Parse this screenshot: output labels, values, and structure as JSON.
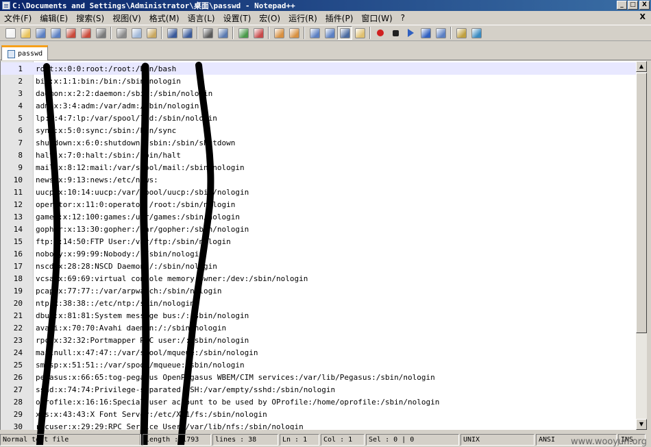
{
  "window": {
    "title": "C:\\Documents and Settings\\Administrator\\桌面\\passwd - Notepad++",
    "caption_buttons": {
      "minimize": "_",
      "maximize": "□",
      "close": "X"
    }
  },
  "menu": {
    "items": [
      "文件(F)",
      "编辑(E)",
      "搜索(S)",
      "视图(V)",
      "格式(M)",
      "语言(L)",
      "设置(T)",
      "宏(O)",
      "运行(R)",
      "插件(P)",
      "窗口(W)",
      "?"
    ],
    "close_label": "X"
  },
  "toolbar": {
    "icons": [
      "new-file-icon",
      "open-file-icon",
      "save-icon",
      "save-all-icon",
      "close-icon",
      "close-all-icon",
      "print-icon",
      "cut-icon",
      "copy-icon",
      "paste-icon",
      "undo-icon",
      "redo-icon",
      "find-icon",
      "replace-icon",
      "zoom-in-icon",
      "zoom-out-icon",
      "sync-v-icon",
      "sync-h-icon",
      "word-wrap-icon",
      "all-chars-icon",
      "indent-guide-icon",
      "user-lang-icon",
      "record-macro-icon",
      "stop-record-icon",
      "play-macro-icon",
      "run-multiple-icon",
      "save-macro-icon",
      "trim-icon",
      "spellcheck-icon"
    ]
  },
  "tabs": [
    {
      "label": "passwd"
    }
  ],
  "editor": {
    "current_line": 1,
    "lines": [
      "root:x:0:0:root:/root:/bin/bash",
      "bin:x:1:1:bin:/bin:/sbin/nologin",
      "daemon:x:2:2:daemon:/sbin:/sbin/nologin",
      "adm:x:3:4:adm:/var/adm:/sbin/nologin",
      "lp:x:4:7:lp:/var/spool/lpd:/sbin/nologin",
      "sync:x:5:0:sync:/sbin:/bin/sync",
      "shutdown:x:6:0:shutdown:/sbin:/sbin/shutdown",
      "halt:x:7:0:halt:/sbin:/sbin/halt",
      "mail:x:8:12:mail:/var/spool/mail:/sbin/nologin",
      "news:x:9:13:news:/etc/news:",
      "uucp:x:10:14:uucp:/var/spool/uucp:/sbin/nologin",
      "operator:x:11:0:operator:/root:/sbin/nologin",
      "games:x:12:100:games:/usr/games:/sbin/nologin",
      "gopher:x:13:30:gopher:/var/gopher:/sbin/nologin",
      "ftp:x:14:50:FTP User:/var/ftp:/sbin/nologin",
      "nobody:x:99:99:Nobody:/:/sbin/nologin",
      "nscd:x:28:28:NSCD Daemon:/:/sbin/nologin",
      "vcsa:x:69:69:virtual console memory owner:/dev:/sbin/nologin",
      "pcap:x:77:77::/var/arpwatch:/sbin/nologin",
      "ntp:x:38:38::/etc/ntp:/sbin/nologin",
      "dbus:x:81:81:System message bus:/:/sbin/nologin",
      "avahi:x:70:70:Avahi daemon:/:/sbin/nologin",
      "rpc:x:32:32:Portmapper RPC user:/:/sbin/nologin",
      "mailnull:x:47:47::/var/spool/mqueue:/sbin/nologin",
      "smmsp:x:51:51::/var/spool/mqueue:/sbin/nologin",
      "pegasus:x:66:65:tog-pegasus OpenPegasus WBEM/CIM services:/var/lib/Pegasus:/sbin/nologin",
      "sshd:x:74:74:Privilege-separated SSH:/var/empty/sshd:/sbin/nologin",
      "oprofile:x:16:16:Special user account to be used by OProfile:/home/oprofile:/sbin/nologin",
      "xfs:x:43:43:X Font Server:/etc/X11/fs:/sbin/nologin",
      "rpcuser:x:29:29:RPC Service User:/var/lib/nfs:/sbin/nologin"
    ]
  },
  "statusbar": {
    "file_type": "Normal text file",
    "length": "length : 1793",
    "lines": "lines : 38",
    "ln": "Ln : 1",
    "col": "Col : 1",
    "sel": "Sel : 0 | 0",
    "eol": "UNIX",
    "encoding": "ANSI",
    "mode": "INS"
  },
  "watermark": "www.wooyun.org"
}
